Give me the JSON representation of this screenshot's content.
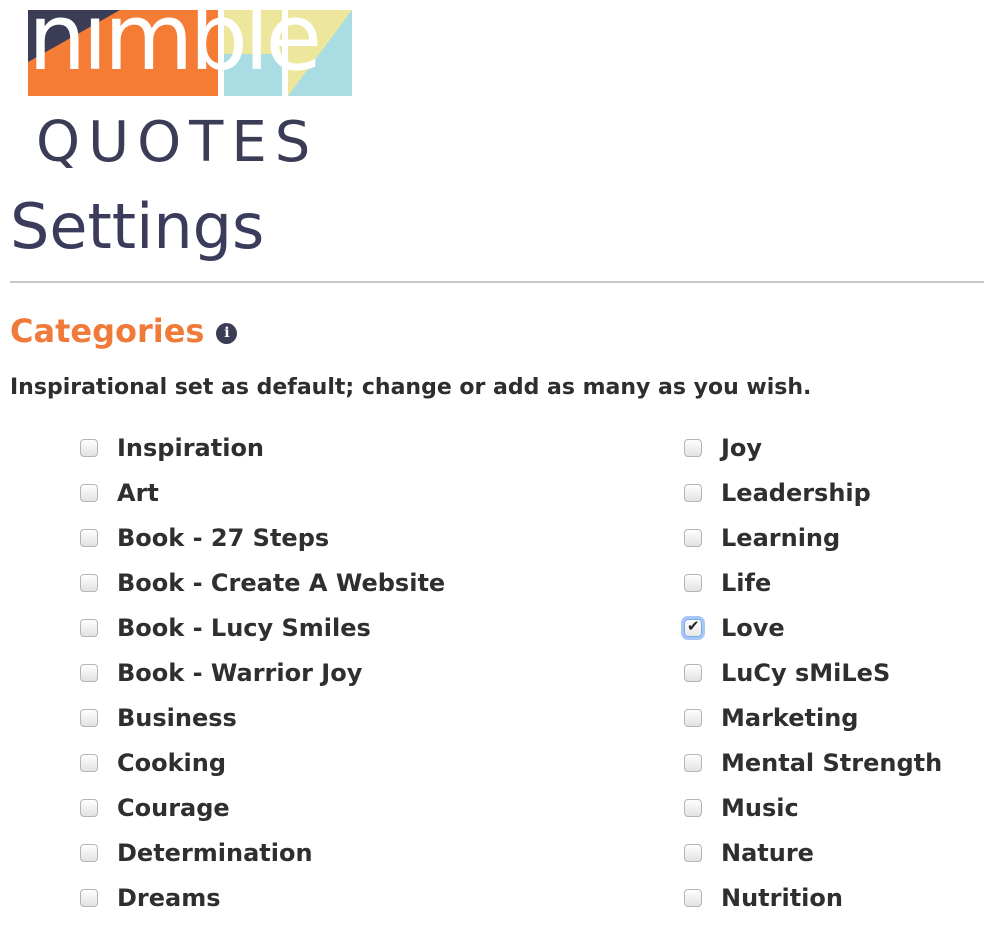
{
  "logo": {
    "top_word": "nimble",
    "bottom_word": "QUOTES",
    "colors": {
      "orange": "#f47c34",
      "navy": "#3b3c55",
      "yellow": "#ede79d",
      "teal": "#a9dde3"
    }
  },
  "page": {
    "title": "Settings"
  },
  "categories": {
    "title": "Categories",
    "info_icon": "info-icon",
    "description": "Inspirational set as default; change or add as many as you wish.",
    "left": [
      {
        "label": "Inspiration",
        "checked": false
      },
      {
        "label": "Art",
        "checked": false
      },
      {
        "label": "Book - 27 Steps",
        "checked": false
      },
      {
        "label": "Book - Create A Website",
        "checked": false
      },
      {
        "label": "Book - Lucy Smiles",
        "checked": false
      },
      {
        "label": "Book - Warrior Joy",
        "checked": false
      },
      {
        "label": "Business",
        "checked": false
      },
      {
        "label": "Cooking",
        "checked": false
      },
      {
        "label": "Courage",
        "checked": false
      },
      {
        "label": "Determination",
        "checked": false
      },
      {
        "label": "Dreams",
        "checked": false
      }
    ],
    "right": [
      {
        "label": "Joy",
        "checked": false
      },
      {
        "label": "Leadership",
        "checked": false
      },
      {
        "label": "Learning",
        "checked": false
      },
      {
        "label": "Life",
        "checked": false
      },
      {
        "label": "Love",
        "checked": true
      },
      {
        "label": "LuCy sMiLeS",
        "checked": false
      },
      {
        "label": "Marketing",
        "checked": false
      },
      {
        "label": "Mental Strength",
        "checked": false
      },
      {
        "label": "Music",
        "checked": false
      },
      {
        "label": "Nature",
        "checked": false
      },
      {
        "label": "Nutrition",
        "checked": false
      }
    ]
  }
}
